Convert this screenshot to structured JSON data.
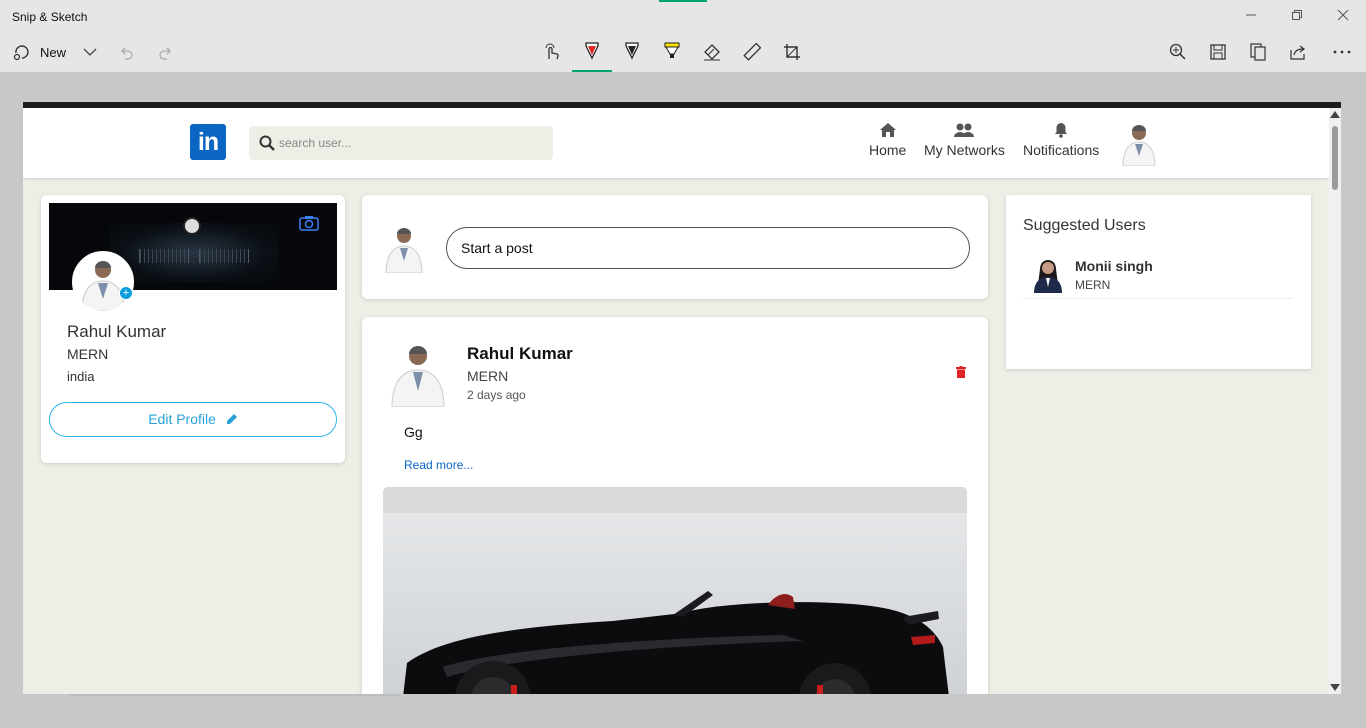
{
  "window": {
    "app_title": "Snip & Sketch"
  },
  "toolbar": {
    "new_label": "New"
  },
  "nav": {
    "logo_text": "in",
    "search_placeholder": "search user...",
    "items": [
      {
        "label": "Home",
        "icon": "home-icon"
      },
      {
        "label": "My Networks",
        "icon": "users-icon"
      },
      {
        "label": "Notifications",
        "icon": "bell-icon"
      }
    ]
  },
  "profile": {
    "name": "Rahul Kumar",
    "role": "MERN",
    "location": "india",
    "edit_label": "Edit Profile"
  },
  "composer": {
    "placeholder": "Start a post"
  },
  "post": {
    "author": "Rahul Kumar",
    "role": "MERN",
    "time": "2 days ago",
    "body": "Gg",
    "read_more": "Read more..."
  },
  "suggested": {
    "title": "Suggested Users",
    "users": [
      {
        "name": "Monii singh",
        "role": "MERN"
      }
    ]
  },
  "colors": {
    "linkedin_blue": "#0a66c2",
    "edit_border": "#2fb3e6",
    "delete_red": "#e02424",
    "accent_green": "#00a86b"
  }
}
